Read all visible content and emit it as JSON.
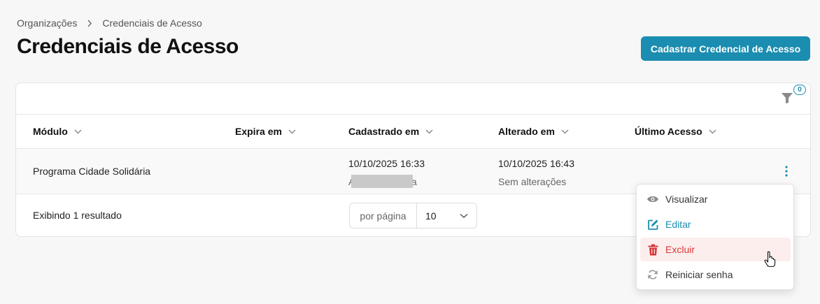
{
  "breadcrumb": {
    "items": [
      "Organizações",
      "Credenciais de Acesso"
    ]
  },
  "page": {
    "title": "Credenciais de Acesso",
    "primary_action": "Cadastrar Credencial de Acesso"
  },
  "filter": {
    "count": "0"
  },
  "table": {
    "columns": [
      "Módulo",
      "Expira em",
      "Cadastrado em",
      "Alterado em",
      "Último Acesso"
    ],
    "rows": [
      {
        "modulo": "Programa Cidade Solidária",
        "expira_em": "",
        "cadastrado_em": "10/10/2025 16:33",
        "cadastrado_por_prefix": "A",
        "cadastrado_por_suffix": "a",
        "alterado_em": "10/10/2025 16:43",
        "alterado_sub": "Sem alterações",
        "ultimo_acesso": ""
      }
    ],
    "result_text": "Exibindo 1 resultado",
    "per_page_label": "por página",
    "per_page_value": "10"
  },
  "row_menu": {
    "items": [
      {
        "label": "Visualizar",
        "icon": "eye-icon"
      },
      {
        "label": "Editar",
        "icon": "edit-icon"
      },
      {
        "label": "Excluir",
        "icon": "trash-icon"
      },
      {
        "label": "Reiniciar senha",
        "icon": "refresh-icon"
      }
    ]
  },
  "colors": {
    "primary": "#1a8db0",
    "danger": "#d93838",
    "danger_bg": "#fdeeee"
  }
}
